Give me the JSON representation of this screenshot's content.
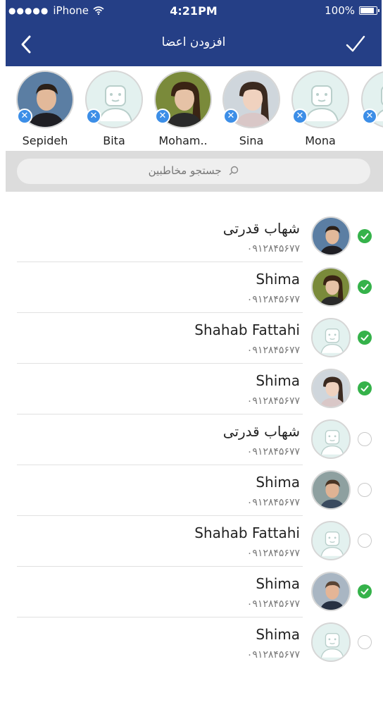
{
  "status_bar": {
    "carrier": "iPhone",
    "time": "4:21PM",
    "battery": "100%"
  },
  "nav": {
    "title": "افزودن اعضا",
    "back_icon": "chevron-left-icon",
    "done_icon": "checkmark-icon"
  },
  "selected_members": [
    {
      "name": "Sepideh",
      "avatar": "photo-man"
    },
    {
      "name": "Bita",
      "avatar": "placeholder"
    },
    {
      "name": "Moham..",
      "avatar": "photo-woman"
    },
    {
      "name": "Sina",
      "avatar": "photo-girl"
    },
    {
      "name": "Mona",
      "avatar": "placeholder"
    },
    {
      "name": "",
      "avatar": "placeholder"
    }
  ],
  "search": {
    "placeholder": "جستجو مخاطبین"
  },
  "contacts": [
    {
      "name": "شهاب قدرتی",
      "phone": "۰۹۱۲۸۴۵۶۷۷",
      "avatar": "photo-man",
      "checked": true
    },
    {
      "name": "Shima",
      "phone": "۰۹۱۲۸۴۵۶۷۷",
      "avatar": "photo-woman",
      "checked": true
    },
    {
      "name": "Shahab Fattahi",
      "phone": "۰۹۱۲۸۴۵۶۷۷",
      "avatar": "placeholder",
      "checked": true
    },
    {
      "name": "Shima",
      "phone": "۰۹۱۲۸۴۵۶۷۷",
      "avatar": "photo-girl",
      "checked": true
    },
    {
      "name": "شهاب قدرتی",
      "phone": "۰۹۱۲۸۴۵۶۷۷",
      "avatar": "placeholder",
      "checked": false
    },
    {
      "name": "Shima",
      "phone": "۰۹۱۲۸۴۵۶۷۷",
      "avatar": "photo-man2",
      "checked": false
    },
    {
      "name": "Shahab Fattahi",
      "phone": "۰۹۱۲۸۴۵۶۷۷",
      "avatar": "placeholder",
      "checked": false
    },
    {
      "name": "Shima",
      "phone": "۰۹۱۲۸۴۵۶۷۷",
      "avatar": "photo-man3",
      "checked": true
    },
    {
      "name": "Shima",
      "phone": "۰۹۱۲۸۴۵۶۷۷",
      "avatar": "placeholder",
      "checked": false
    }
  ],
  "colors": {
    "nav_bg": "#253f86",
    "check_on": "#35b24a",
    "remove_badge": "#3c8ee7",
    "placeholder_bg": "#e3f1ef"
  }
}
